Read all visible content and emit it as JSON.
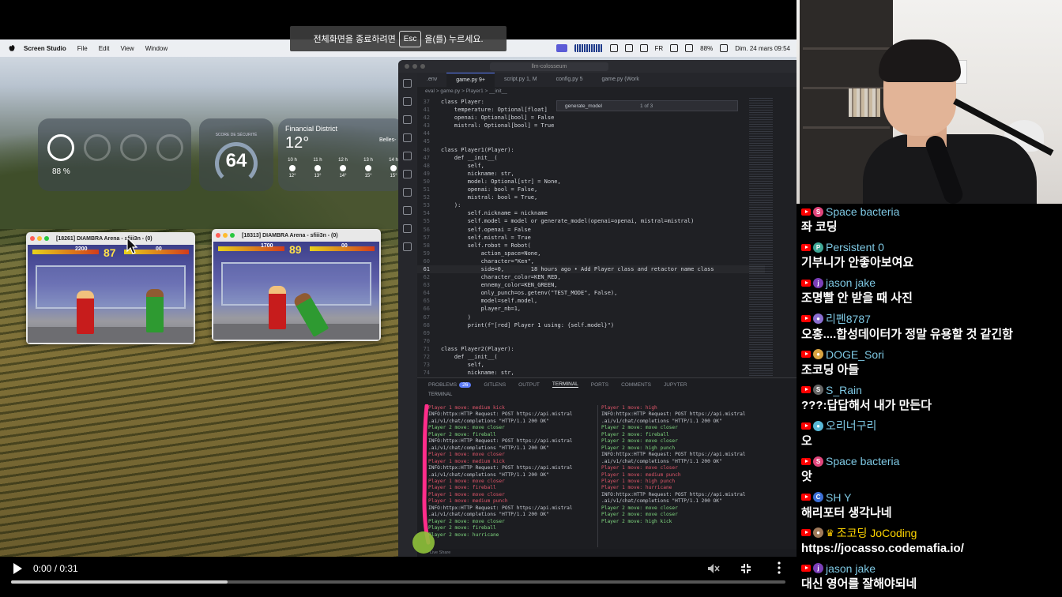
{
  "fullscreen_notice": {
    "before": "전체화면을 종료하려면",
    "key": "Esc",
    "after": "을(를) 누르세요."
  },
  "menubar": {
    "app": "Screen Studio",
    "items": [
      "File",
      "Edit",
      "View",
      "Window"
    ],
    "battery": "88%",
    "input_lang": "FR",
    "datetime": "Dim. 24 mars 09:54"
  },
  "widgets": {
    "battery_pct": "88 %",
    "security_label": "SCORE DE SÉCURITÉ",
    "security_score": "64",
    "weather": {
      "city": "Financial District",
      "temp": "12°",
      "city2": "Belles-",
      "hours": [
        {
          "h": "10 h",
          "t": "12°"
        },
        {
          "h": "11 h",
          "t": "13°"
        },
        {
          "h": "12 h",
          "t": "14°"
        },
        {
          "h": "13 h",
          "t": "15°"
        },
        {
          "h": "14 h",
          "t": "15°"
        }
      ]
    }
  },
  "game_windows": [
    {
      "title": "[18261] DIAMBRA Arena - sfiii3n - (0)",
      "score_left": "2200",
      "timer": "87",
      "score_right": "00"
    },
    {
      "title": "[18313] DIAMBRA Arena - sfiii3n - (0)",
      "score_left": "1700",
      "timer": "89",
      "score_right": "00"
    }
  ],
  "editor": {
    "search": "llm-colosseum",
    "tabs": [
      ".env",
      "game.py 9+",
      "script.py 1, M",
      "config.py 5",
      "game.py (Work"
    ],
    "breadcrumb": "eval > game.py > Player1 > __init__",
    "find": {
      "query": "generate_model",
      "count": "1 of 3"
    },
    "code_lines": [
      {
        "n": "37",
        "t": "class Player:"
      },
      {
        "n": "41",
        "t": "    temperature: Optional[float]"
      },
      {
        "n": "42",
        "t": "    openai: Optional[bool] = False"
      },
      {
        "n": "43",
        "t": "    mistral: Optional[bool] = True"
      },
      {
        "n": "44",
        "t": ""
      },
      {
        "n": "45",
        "t": ""
      },
      {
        "n": "46",
        "t": "class Player1(Player):"
      },
      {
        "n": "47",
        "t": "    def __init__("
      },
      {
        "n": "48",
        "t": "        self,"
      },
      {
        "n": "49",
        "t": "        nickname: str,"
      },
      {
        "n": "50",
        "t": "        model: Optional[str] = None,"
      },
      {
        "n": "51",
        "t": "        openai: bool = False,"
      },
      {
        "n": "52",
        "t": "        mistral: bool = True,"
      },
      {
        "n": "53",
        "t": "    ):"
      },
      {
        "n": "54",
        "t": "        self.nickname = nickname"
      },
      {
        "n": "55",
        "t": "        self.model = model or generate_model(openai=openai, mistral=mistral)"
      },
      {
        "n": "56",
        "t": "        self.openai = False"
      },
      {
        "n": "57",
        "t": "        self.mistral = True"
      },
      {
        "n": "58",
        "t": "        self.robot = Robot("
      },
      {
        "n": "59",
        "t": "            action_space=None,"
      },
      {
        "n": "60",
        "t": "            character=\"Ken\","
      },
      {
        "n": "61",
        "t": "            side=0,        18 hours ago • Add Player class and retactor name class"
      },
      {
        "n": "62",
        "t": "            character_color=KEN_RED,"
      },
      {
        "n": "63",
        "t": "            ennemy_color=KEN_GREEN,"
      },
      {
        "n": "64",
        "t": "            only_punch=os.getenv(\"TEST_MODE\", False),"
      },
      {
        "n": "65",
        "t": "            model=self.model,"
      },
      {
        "n": "66",
        "t": "            player_nb=1,"
      },
      {
        "n": "67",
        "t": "        )"
      },
      {
        "n": "68",
        "t": "        print(f\"[red] Player 1 using: {self.model}\")"
      },
      {
        "n": "69",
        "t": ""
      },
      {
        "n": "70",
        "t": ""
      },
      {
        "n": "71",
        "t": "class Player2(Player):"
      },
      {
        "n": "72",
        "t": "    def __init__("
      },
      {
        "n": "73",
        "t": "        self,"
      },
      {
        "n": "74",
        "t": "        nickname: str,"
      }
    ],
    "panel_tabs": [
      "PROBLEMS",
      "GITLENS",
      "OUTPUT",
      "TERMINAL",
      "PORTS",
      "COMMENTS",
      "JUPYTER"
    ],
    "problems_count": "26",
    "terminal_label": "TERMINAL",
    "term_left": [
      {
        "c": "p1",
        "t": "Player 1 move: medium kick"
      },
      {
        "c": "info",
        "t": "INFO:httpx:HTTP Request: POST https://api.mistral"
      },
      {
        "c": "info",
        "t": ".ai/v1/chat/completions \"HTTP/1.1 200 OK\""
      },
      {
        "c": "p2",
        "t": "Player 2 move: move closer"
      },
      {
        "c": "p2",
        "t": "Player 2 move: fireball"
      },
      {
        "c": "info",
        "t": "INFO:httpx:HTTP Request: POST https://api.mistral"
      },
      {
        "c": "info",
        "t": ".ai/v1/chat/completions \"HTTP/1.1 200 OK\""
      },
      {
        "c": "p1",
        "t": "Player 1 move: move closer"
      },
      {
        "c": "p1",
        "t": "Player 1 move: medium kick"
      },
      {
        "c": "info",
        "t": "INFO:httpx:HTTP Request: POST https://api.mistral"
      },
      {
        "c": "info",
        "t": ".ai/v1/chat/completions \"HTTP/1.1 200 OK\""
      },
      {
        "c": "p1",
        "t": "Player 1 move: move closer"
      },
      {
        "c": "p1",
        "t": "Player 1 move: fireball"
      },
      {
        "c": "p1",
        "t": "Player 1 move: move closer"
      },
      {
        "c": "p1",
        "t": "Player 1 move: medium punch"
      },
      {
        "c": "info",
        "t": "INFO:httpx:HTTP Request: POST https://api.mistral"
      },
      {
        "c": "info",
        "t": ".ai/v1/chat/completions \"HTTP/1.1 200 OK\""
      },
      {
        "c": "p2",
        "t": "Player 2 move: move closer"
      },
      {
        "c": "p2",
        "t": "Player 2 move: fireball"
      },
      {
        "c": "p2",
        "t": "Player 2 move: hurricane"
      }
    ],
    "term_right": [
      {
        "c": "p1",
        "t": "Player 1 move: high"
      },
      {
        "c": "info",
        "t": "INFO:httpx:HTTP Request: POST https://api.mistral"
      },
      {
        "c": "info",
        "t": ".ai/v1/chat/completions \"HTTP/1.1 200 OK\""
      },
      {
        "c": "p2",
        "t": "Player 2 move: move closer"
      },
      {
        "c": "p2",
        "t": "Player 2 move: fireball"
      },
      {
        "c": "p2",
        "t": "Player 2 move: move closer"
      },
      {
        "c": "p2",
        "t": "Player 2 move: high punch"
      },
      {
        "c": "info",
        "t": "INFO:httpx:HTTP Request: POST https://api.mistral"
      },
      {
        "c": "info",
        "t": ".ai/v1/chat/completions \"HTTP/1.1 200 OK\""
      },
      {
        "c": "p1",
        "t": "Player 1 move: move closer"
      },
      {
        "c": "p1",
        "t": "Player 1 move: medium punch"
      },
      {
        "c": "p1",
        "t": "Player 1 move: high punch"
      },
      {
        "c": "p1",
        "t": "Player 1 move: hurricane"
      },
      {
        "c": "info",
        "t": "INFO:httpx:HTTP Request: POST https://api.mistral"
      },
      {
        "c": "info",
        "t": ".ai/v1/chat/completions \"HTTP/1.1 200 OK\""
      },
      {
        "c": "p2",
        "t": "Player 2 move: move closer"
      },
      {
        "c": "p2",
        "t": "Player 2 move: move closer"
      },
      {
        "c": "p2",
        "t": "Player 2 move: high kick"
      }
    ],
    "statusbar": "Live Share"
  },
  "video": {
    "time": "0:00 / 0:31",
    "progress": 0.28
  },
  "chat": [
    {
      "user": "Space bacteria",
      "avatar": "S",
      "avatar_color": "#e0457b",
      "name_color": "#7ec8e3",
      "text": "좌 코딩",
      "owner": false
    },
    {
      "user": "Persistent 0",
      "avatar": "P",
      "avatar_color": "#3fa796",
      "name_color": "#7ec8e3",
      "text": "기부니가 안좋아보여요",
      "owner": false
    },
    {
      "user": "jason jake",
      "avatar": "j",
      "avatar_color": "#7b3fb8",
      "name_color": "#7ec8e3",
      "text": "조명빨 안 받을 때 사진",
      "owner": false
    },
    {
      "user": "리펜8787",
      "avatar": "●",
      "avatar_color": "#8a6ed1",
      "name_color": "#7ec8e3",
      "text": "오홍....합성데이터가 정말 유용할 것 같긴함",
      "owner": false
    },
    {
      "user": "DOGE_Sori",
      "avatar": "●",
      "avatar_color": "#d9a441",
      "name_color": "#7ec8e3",
      "text": "조코딩 아들",
      "owner": false
    },
    {
      "user": "S_Rain",
      "avatar": "S",
      "avatar_color": "#666666",
      "name_color": "#7ec8e3",
      "text": "???:답답해서 내가 만든다",
      "owner": false
    },
    {
      "user": "오리너구리",
      "avatar": "●",
      "avatar_color": "#58b7d6",
      "name_color": "#7ec8e3",
      "text": "오",
      "owner": false
    },
    {
      "user": "Space bacteria",
      "avatar": "S",
      "avatar_color": "#e0457b",
      "name_color": "#7ec8e3",
      "text": "앗",
      "owner": false
    },
    {
      "user": "SH Y",
      "avatar": "C",
      "avatar_color": "#3b6fd6",
      "name_color": "#7ec8e3",
      "text": "해리포터 생각나네",
      "owner": false
    },
    {
      "user": "조코딩 JoCoding",
      "avatar": "●",
      "avatar_color": "#a07a5a",
      "name_color": "#ffd600",
      "text": "https://jocasso.codemafia.io/",
      "owner": true
    },
    {
      "user": "jason jake",
      "avatar": "j",
      "avatar_color": "#7b3fb8",
      "name_color": "#7ec8e3",
      "text": "대신 영어를 잘해야되네",
      "owner": false
    }
  ]
}
